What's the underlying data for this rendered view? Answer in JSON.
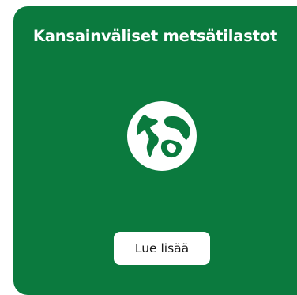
{
  "card": {
    "title": "Kansainväliset metsätilastot",
    "icon": "globe-icon",
    "button_label": "Lue lisää",
    "background_color": "#0b7a3e",
    "text_color": "#ffffff"
  }
}
